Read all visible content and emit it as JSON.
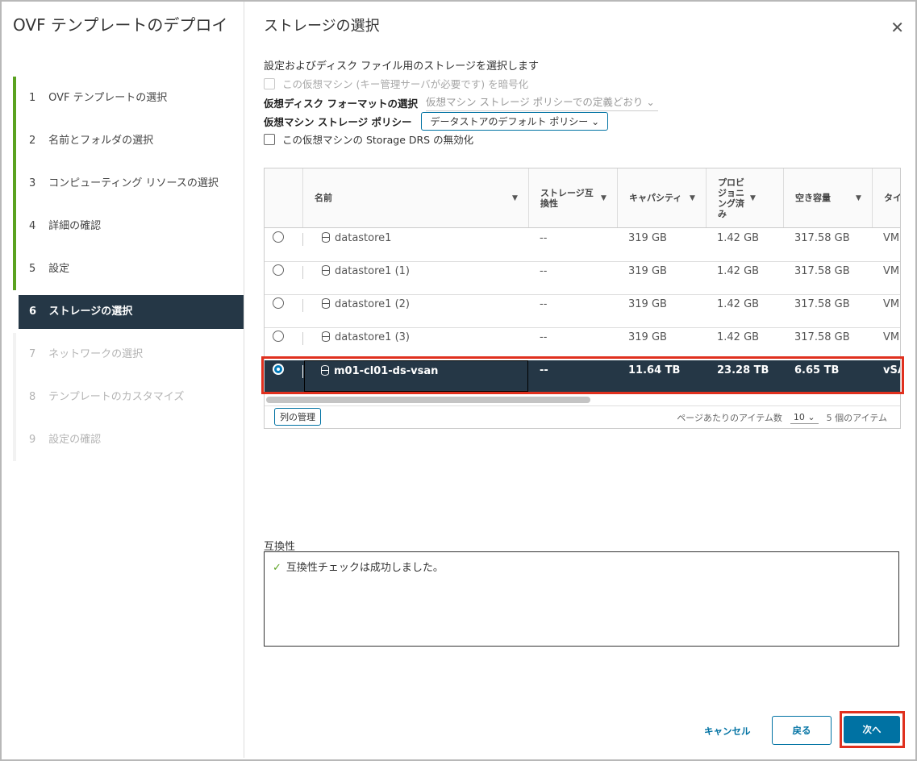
{
  "wizard": {
    "title": "OVF テンプレートのデプロイ",
    "steps": [
      {
        "num": "1",
        "label": "OVF テンプレートの選択"
      },
      {
        "num": "2",
        "label": "名前とフォルダの選択"
      },
      {
        "num": "3",
        "label": "コンピューティング リソースの選択"
      },
      {
        "num": "4",
        "label": "詳細の確認"
      },
      {
        "num": "5",
        "label": "設定"
      },
      {
        "num": "6",
        "label": "ストレージの選択"
      },
      {
        "num": "7",
        "label": "ネットワークの選択"
      },
      {
        "num": "8",
        "label": "テンプレートのカスタマイズ"
      },
      {
        "num": "9",
        "label": "設定の確認"
      }
    ]
  },
  "page": {
    "title": "ストレージの選択",
    "description": "設定およびディスク ファイル用のストレージを選択します",
    "encrypt_label": "この仮想マシン (キー管理サーバが必要です) を暗号化",
    "disk_format_label": "仮想ディスク フォーマットの選択",
    "disk_format_value": "仮想マシン ストレージ ポリシーでの定義どおり",
    "policy_label": "仮想マシン ストレージ ポリシー",
    "policy_value": "データストアのデフォルト ポリシー",
    "sdrs_label": "この仮想マシンの Storage DRS の無効化"
  },
  "table": {
    "headers": {
      "name": "名前",
      "compat": "ストレージ互換性",
      "capacity": "キャパシティ",
      "provisioned": "プロビジョニング済み",
      "free": "空き容量",
      "type": "タイ"
    },
    "rows": [
      {
        "name": "datastore1",
        "compat": "--",
        "capacity": "319 GB",
        "provisioned": "1.42 GB",
        "free": "317.58 GB",
        "type": "VM"
      },
      {
        "name": "datastore1 (1)",
        "compat": "--",
        "capacity": "319 GB",
        "provisioned": "1.42 GB",
        "free": "317.58 GB",
        "type": "VM"
      },
      {
        "name": "datastore1 (2)",
        "compat": "--",
        "capacity": "319 GB",
        "provisioned": "1.42 GB",
        "free": "317.58 GB",
        "type": "VM"
      },
      {
        "name": "datastore1 (3)",
        "compat": "--",
        "capacity": "319 GB",
        "provisioned": "1.42 GB",
        "free": "317.58 GB",
        "type": "VM"
      },
      {
        "name": "m01-cl01-ds-vsan",
        "compat": "--",
        "capacity": "11.64 TB",
        "provisioned": "23.28 TB",
        "free": "6.65 TB",
        "type": "vSA"
      }
    ],
    "manage_columns": "列の管理",
    "items_per_page_label": "ページあたりのアイテム数",
    "items_per_page_value": "10",
    "item_count": "5 個のアイテム"
  },
  "compatibility": {
    "label": "互換性",
    "message": "互換性チェックは成功しました。"
  },
  "buttons": {
    "cancel": "キャンセル",
    "back": "戻る",
    "next": "次へ"
  }
}
